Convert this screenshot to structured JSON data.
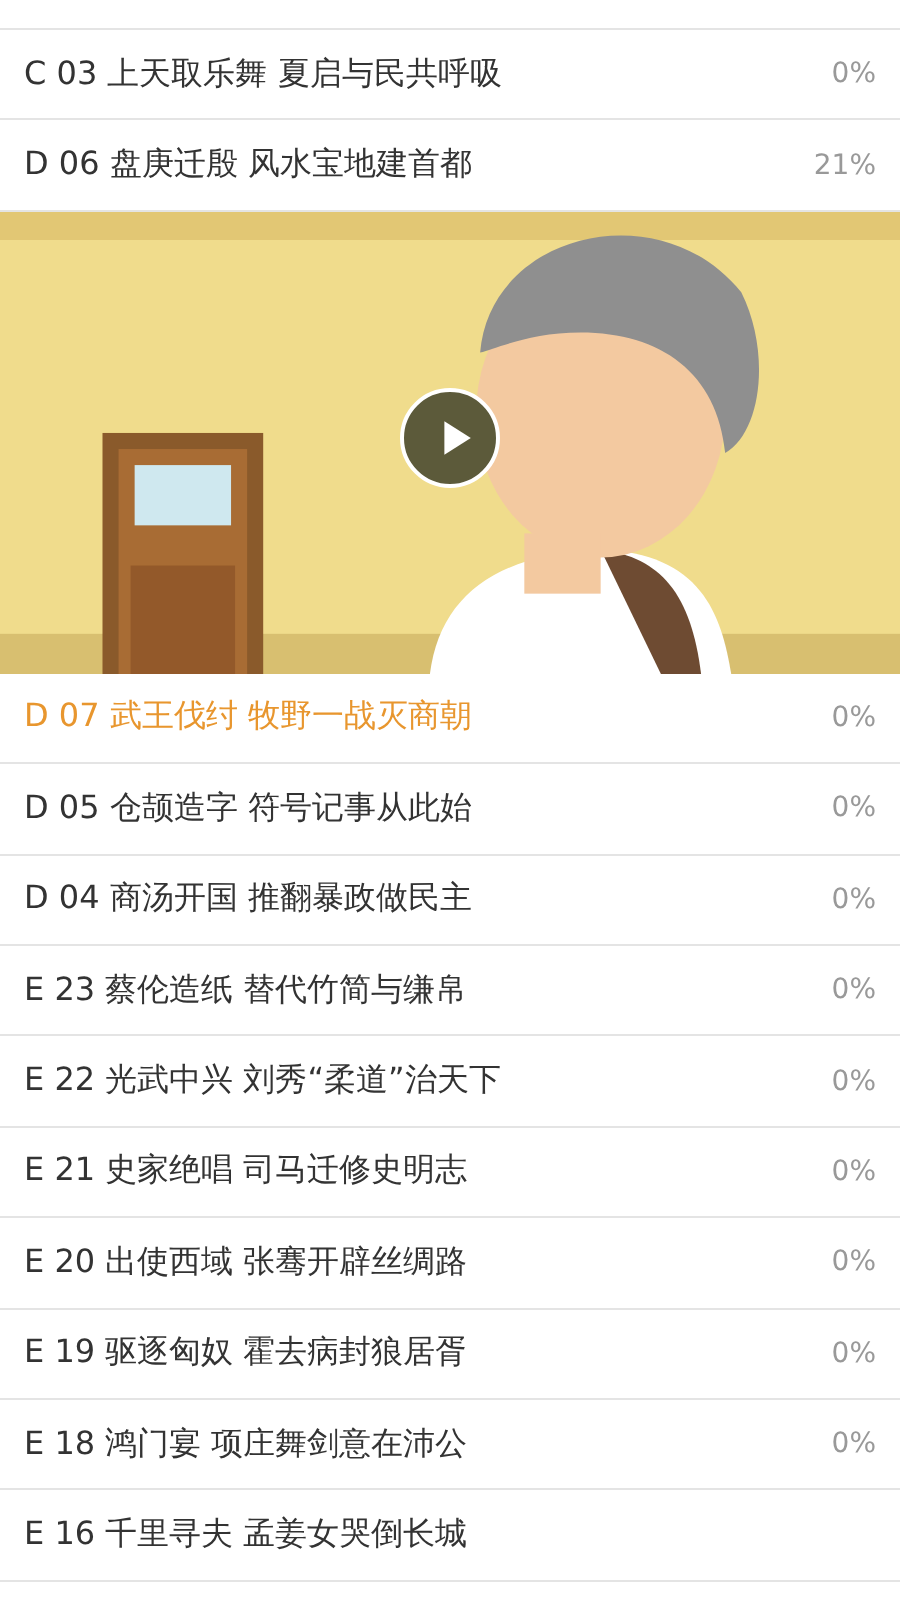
{
  "lessons_before": [
    {
      "title": "C 03 上天取乐舞 夏启与民共呼吸",
      "progress": "0%",
      "selected": false
    },
    {
      "title": "D 06 盘庚迁殷 风水宝地建首都",
      "progress": "21%",
      "selected": false
    }
  ],
  "lessons_after": [
    {
      "title": "D 07 武王伐纣 牧野一战灭商朝",
      "progress": "0%",
      "selected": true
    },
    {
      "title": "D 05 仓颉造字 符号记事从此始",
      "progress": "0%",
      "selected": false
    },
    {
      "title": "D 04 商汤开国 推翻暴政做民主",
      "progress": "0%",
      "selected": false
    },
    {
      "title": "E 23 蔡伦造纸 替代竹简与缣帛",
      "progress": "0%",
      "selected": false
    },
    {
      "title": "E 22 光武中兴 刘秀“柔道”治天下",
      "progress": "0%",
      "selected": false
    },
    {
      "title": "E 21 史家绝唱 司马迁修史明志",
      "progress": "0%",
      "selected": false
    },
    {
      "title": "E 20 出使西域 张骞开辟丝绸路",
      "progress": "0%",
      "selected": false
    },
    {
      "title": "E 19 驱逐匈奴 霍去病封狼居胥",
      "progress": "0%",
      "selected": false
    },
    {
      "title": "E 18 鸿门宴 项庄舞剑意在沛公",
      "progress": "0%",
      "selected": false
    },
    {
      "title": "E 16 千里寻夫 孟姜女哭倒长城",
      "selected": false
    }
  ]
}
